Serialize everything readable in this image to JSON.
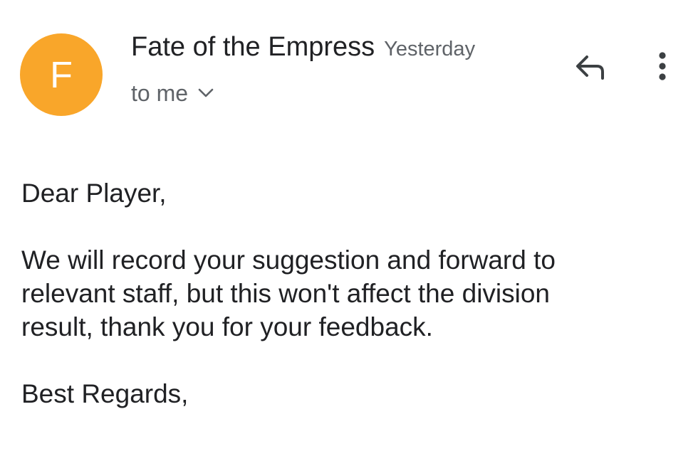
{
  "colors": {
    "avatar_bg": "#F9A62A",
    "avatar_text": "#FFFFFF",
    "primary_text": "#202124",
    "secondary_text": "#5F6368"
  },
  "header": {
    "avatar_letter": "F",
    "sender_name": "Fate of the Empress",
    "timestamp": "Yesterday",
    "recipient": "to me",
    "recipient_icon": "chevron-down-icon",
    "reply_icon": "reply-icon",
    "more_icon": "more-vert-icon"
  },
  "message": {
    "greeting": "Dear Player,",
    "paragraph": "We will record your suggestion and forward to\nrelevant staff, but this won't affect the division\nresult, thank you for your feedback.",
    "closing": "Best Regards,"
  }
}
